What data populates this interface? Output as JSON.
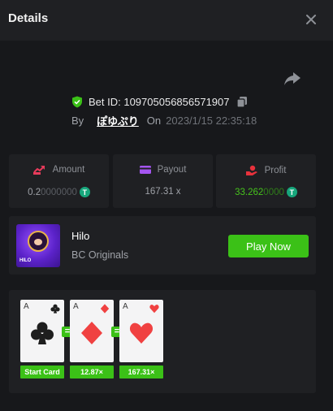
{
  "header": {
    "title": "Details"
  },
  "bet": {
    "id_label": "Bet ID: 109705056856571907",
    "by_label": "By",
    "user": "ぽゆぷり",
    "on_label": "On",
    "date": "2023/1/15 22:35:18"
  },
  "stats": {
    "amount": {
      "label": "Amount",
      "value_main": "0.2",
      "value_dim": "0000000",
      "coin": "T"
    },
    "payout": {
      "label": "Payout",
      "value": "167.31 x"
    },
    "profit": {
      "label": "Profit",
      "value_main": "33.262",
      "value_dim": "0000",
      "coin": "T"
    }
  },
  "game": {
    "thumb_label": "HILO",
    "name": "Hilo",
    "provider": "BC Originals",
    "play_label": "Play Now"
  },
  "cards": [
    {
      "rank": "A",
      "suit": "club",
      "chip": "Start Card"
    },
    {
      "rank": "A",
      "suit": "diamond",
      "chip": "12.87×"
    },
    {
      "rank": "A",
      "suit": "heart",
      "chip": "167.31×"
    }
  ],
  "equals_symbol": "=",
  "colors": {
    "accent_green": "#3bc117",
    "panel": "#1f2023",
    "background": "#17181b",
    "tether": "#17a77c"
  }
}
